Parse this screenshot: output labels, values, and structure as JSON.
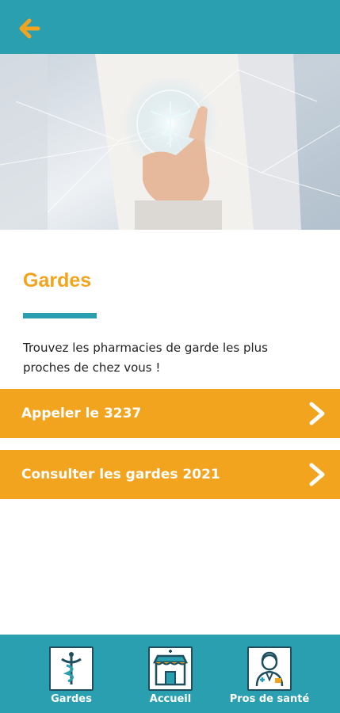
{
  "header": {
    "back_icon": "arrow-left-icon",
    "back_color": "#f2a41e",
    "bar_color": "#2a9fb0"
  },
  "hero": {
    "description_icon": "caduceus-hologram-icon"
  },
  "content": {
    "title": "Gardes",
    "description": "Trouvez les pharmacies de garde les plus proches de chez vous !"
  },
  "actions": [
    {
      "label": "Appeler le 3237",
      "icon": "chevron-right-icon"
    },
    {
      "label": "Consulter les gardes 2021",
      "icon": "chevron-right-icon"
    }
  ],
  "bottom_nav": {
    "items": [
      {
        "label": "Gardes",
        "icon": "caduceus-icon"
      },
      {
        "label": "Accueil",
        "icon": "pharmacy-store-icon"
      },
      {
        "label": "Pros de santé",
        "icon": "doctor-icon"
      }
    ]
  },
  "colors": {
    "accent": "#f2a41e",
    "primary": "#2a9fb0"
  }
}
